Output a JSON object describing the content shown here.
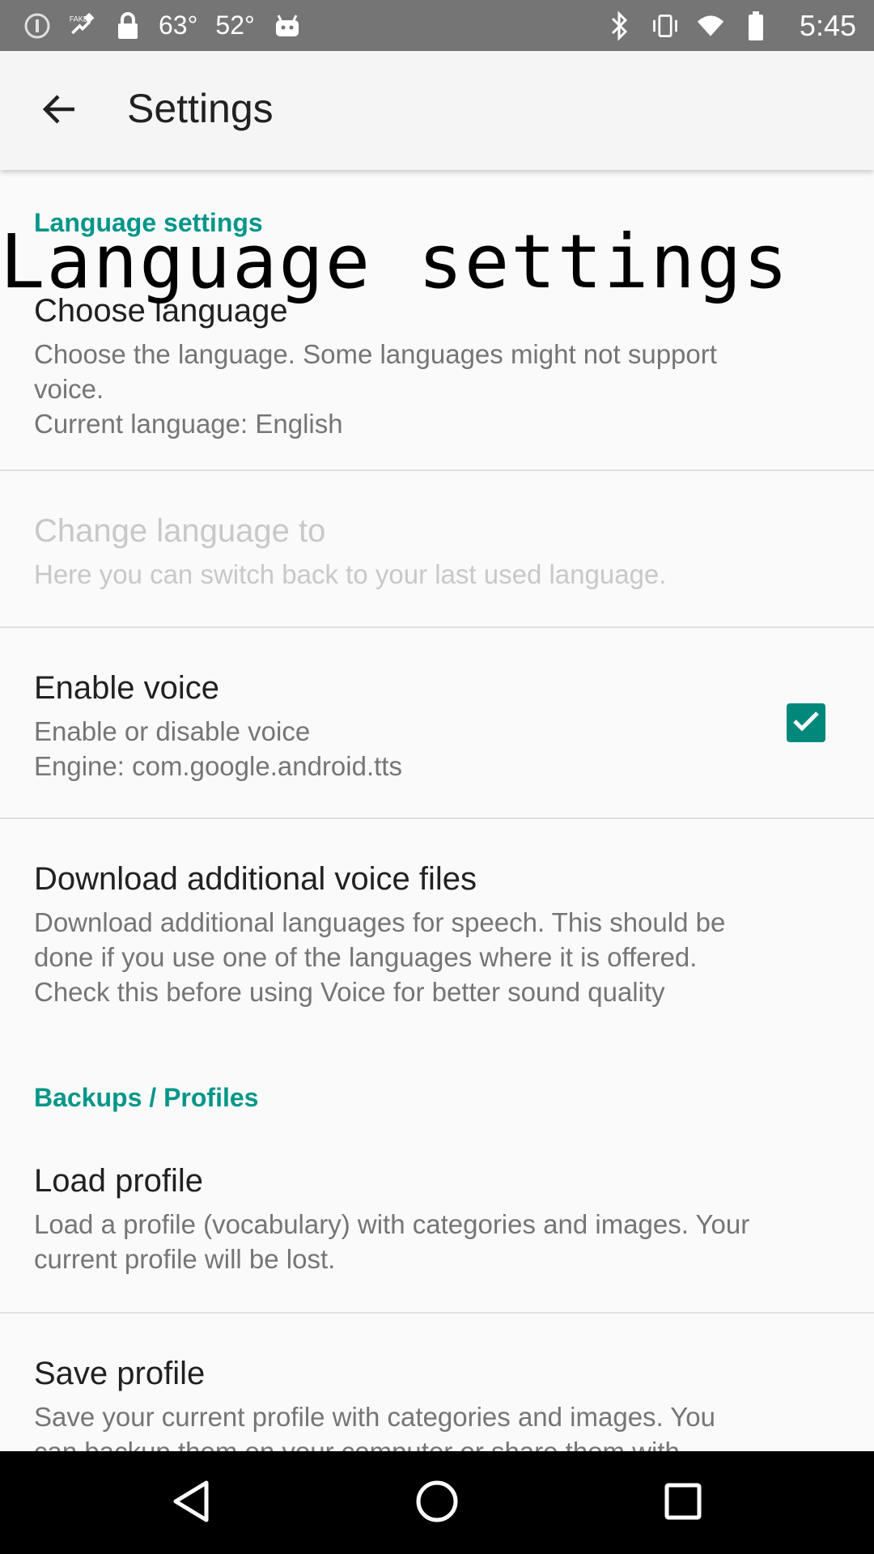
{
  "status_bar": {
    "temp_high": "63°",
    "temp_low": "52°",
    "time": "5:45",
    "icons_left": [
      "alert-circle-icon",
      "fake-gps-icon",
      "lock-icon",
      "android-icon"
    ],
    "icons_right": [
      "bluetooth-icon",
      "vibrate-icon",
      "wifi-icon",
      "battery-icon"
    ]
  },
  "toolbar": {
    "title": "Settings",
    "back_icon": "arrow-back-icon"
  },
  "overlay_label": "Language settings",
  "sections": {
    "language": {
      "header": "Language settings"
    },
    "backups": {
      "header": "Backups / Profiles"
    }
  },
  "prefs": {
    "choose_language": {
      "title": "Choose language",
      "summary": "Choose the language. Some languages might not support\nvoice.\nCurrent language: English"
    },
    "change_language": {
      "title": "Change language to",
      "summary": "Here you can switch back to your last used language."
    },
    "enable_voice": {
      "title": "Enable voice",
      "summary": "Enable or disable voice\nEngine: com.google.android.tts",
      "checked": true
    },
    "download_voice": {
      "title": "Download additional voice files",
      "summary": "Download additional languages for speech. This should be\ndone if you use one of the languages where it is offered.\nCheck this before using Voice for better sound quality"
    },
    "load_profile": {
      "title": "Load profile",
      "summary": "Load a profile (vocabulary) with categories and images. Your\ncurrent profile will be lost."
    },
    "save_profile": {
      "title": "Save profile",
      "summary": "Save your current profile with categories and images. You\ncan backup them on your computer or share them with"
    }
  },
  "colors": {
    "accent": "#009688",
    "checkbox": "#00897b",
    "statusbar": "#757575"
  },
  "nav_bar": {
    "icons": [
      "back-triangle-icon",
      "home-circle-icon",
      "recents-square-icon"
    ]
  }
}
